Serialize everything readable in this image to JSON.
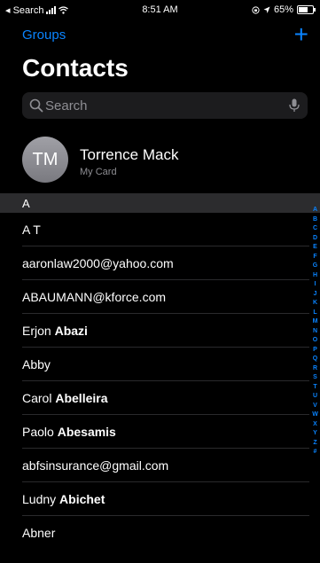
{
  "status_bar": {
    "back_label": "◂ Search",
    "time": "8:51 AM",
    "battery_text": "65%",
    "battery_level": 0.65
  },
  "nav": {
    "groups_label": "Groups",
    "add_label": "+"
  },
  "title": "Contacts",
  "search": {
    "placeholder": "Search"
  },
  "my_card": {
    "initials": "TM",
    "name": "Torrence Mack",
    "subtitle": "My Card"
  },
  "section": {
    "letter": "A"
  },
  "contacts": [
    {
      "first": "A T",
      "last": ""
    },
    {
      "first": "aaronlaw2000@yahoo.com",
      "last": ""
    },
    {
      "first": "ABAUMANN@kforce.com",
      "last": ""
    },
    {
      "first": "Erjon",
      "last": "Abazi"
    },
    {
      "first": "Abby",
      "last": ""
    },
    {
      "first": "Carol",
      "last": "Abelleira"
    },
    {
      "first": "Paolo",
      "last": "Abesamis"
    },
    {
      "first": "abfsinsurance@gmail.com",
      "last": ""
    },
    {
      "first": "Ludny",
      "last": "Abichet"
    },
    {
      "first": "Abner",
      "last": ""
    }
  ],
  "index_letters": [
    "A",
    "B",
    "C",
    "D",
    "E",
    "F",
    "G",
    "H",
    "I",
    "J",
    "K",
    "L",
    "M",
    "N",
    "O",
    "P",
    "Q",
    "R",
    "S",
    "T",
    "U",
    "V",
    "W",
    "X",
    "Y",
    "Z",
    "#"
  ],
  "colors": {
    "accent": "#0a84ff",
    "background": "#000000",
    "section_header": "#2c2c2e"
  }
}
